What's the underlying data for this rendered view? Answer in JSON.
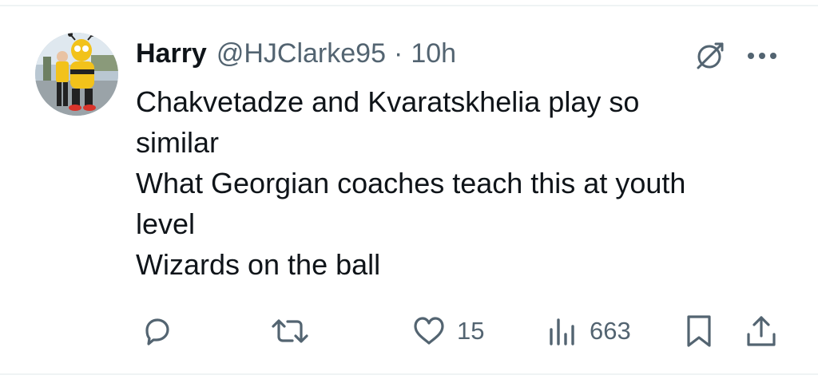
{
  "tweet": {
    "author_name": "Harry",
    "handle": "@HJClarke95",
    "separator": "·",
    "time": "10h",
    "text_lines": [
      "Chakvetadze and Kvaratskhelia play so",
      "similar",
      "What Georgian coaches teach this at youth",
      "level",
      "Wizards on the ball"
    ]
  },
  "actions": {
    "reply": {
      "icon": "reply-icon"
    },
    "retweet": {
      "icon": "retweet-icon"
    },
    "like": {
      "icon": "heart-icon",
      "count": "15"
    },
    "views": {
      "icon": "views-icon",
      "count": "663"
    },
    "bookmark": {
      "icon": "bookmark-icon"
    },
    "share": {
      "icon": "share-icon"
    }
  },
  "colors": {
    "text_primary": "#0f1419",
    "text_secondary": "#536471",
    "divider": "#eff3f4"
  }
}
